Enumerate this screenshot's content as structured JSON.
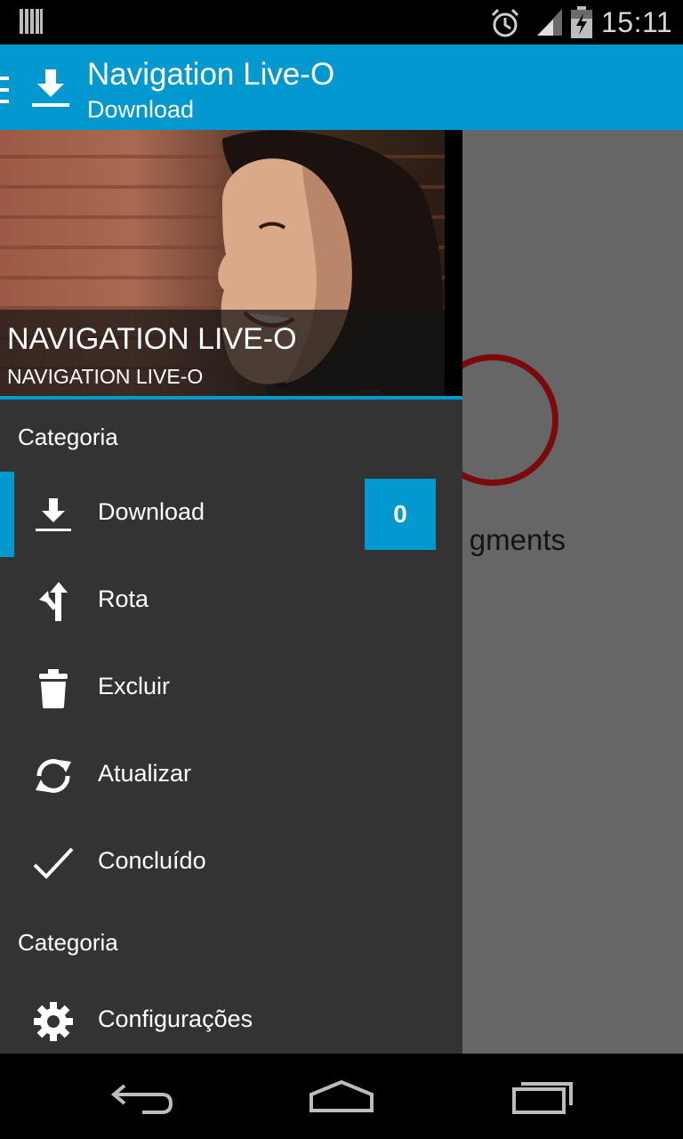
{
  "status_bar": {
    "time": "15:11",
    "icons": [
      "barcode-icon",
      "alarm-icon",
      "signal-icon",
      "battery-charging-icon"
    ]
  },
  "action_bar": {
    "title": "Navigation Live-O",
    "subtitle": "Download",
    "icons": [
      "menu-icon",
      "download-icon"
    ]
  },
  "content": {
    "partial_text": "gments"
  },
  "drawer": {
    "header": {
      "title": "NAVIGATION LIVE-O",
      "subtitle": "NAVIGATION LIVE-O"
    },
    "sections": [
      {
        "label": "Categoria",
        "items": [
          {
            "label": "Download",
            "icon": "download-icon",
            "badge": "0",
            "selected": true
          },
          {
            "label": "Rota",
            "icon": "route-icon"
          },
          {
            "label": "Excluir",
            "icon": "trash-icon"
          },
          {
            "label": "Atualizar",
            "icon": "refresh-icon"
          },
          {
            "label": "Concluído",
            "icon": "check-icon"
          }
        ]
      },
      {
        "label": "Categoria",
        "items": [
          {
            "label": "Configurações",
            "icon": "settings-gear-icon"
          }
        ]
      }
    ]
  },
  "nav_bar": {
    "buttons": [
      "back-icon",
      "home-icon",
      "recent-apps-icon"
    ]
  },
  "colors": {
    "accent": "#0399d0",
    "drawer_bg": "#333333",
    "content_bg": "#666666",
    "progress_ring": "#7b0b0b"
  }
}
